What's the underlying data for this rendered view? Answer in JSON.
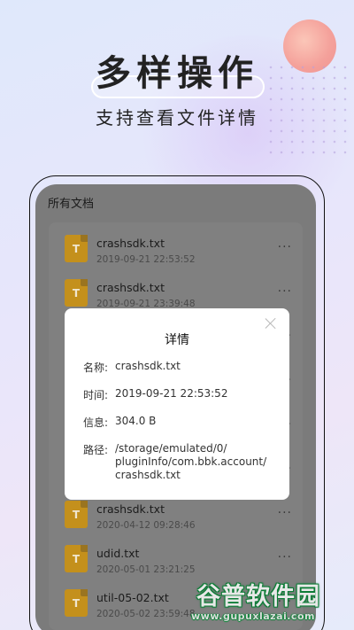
{
  "promo": {
    "headline": "多样操作",
    "subline": "支持查看文件详情"
  },
  "screen": {
    "title": "所有文档"
  },
  "files": [
    {
      "name": "crashsdk.txt",
      "time": "2019-09-21 22:53:52",
      "icon_letter": "T"
    },
    {
      "name": "crashsdk.txt",
      "time": "2019-09-21 23:39:48",
      "icon_letter": "T"
    },
    {
      "name": "crashsdk.txt",
      "time": "2020-04-12 09:28:46",
      "icon_letter": "T"
    },
    {
      "name": "udid.txt",
      "time": "2020-05-01 23:21:25",
      "icon_letter": "T"
    },
    {
      "name": "util-05-02.txt",
      "time": "2020-05-02 23:59:48",
      "icon_letter": "T"
    }
  ],
  "more_label": "···",
  "dialog": {
    "title": "详情",
    "name_label": "名称:",
    "name_value": "crashsdk.txt",
    "time_label": "时间:",
    "time_value": "2019-09-21 22:53:52",
    "info_label": "信息:",
    "info_value": "304.0 B",
    "path_label": "路径:",
    "path_value": "/storage/emulated/0/pluginInfo/com.bbk.account/crashsdk.txt"
  },
  "watermark": {
    "brand": "谷普软件园",
    "url": "www.gupuxlazai.com"
  },
  "colors": {
    "file_icon": "#c4901c",
    "overlay": "#7b7b7b",
    "dialog_bg": "#ffffff",
    "watermark_green": "#0e7d37"
  }
}
